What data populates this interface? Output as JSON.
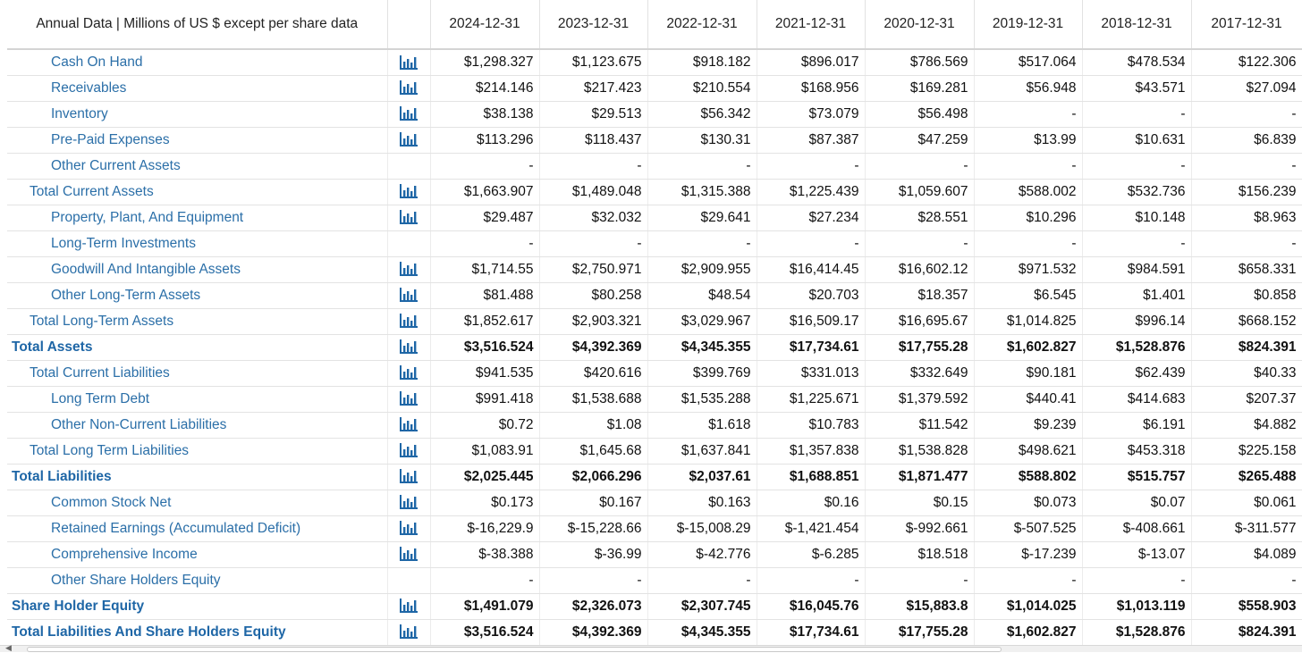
{
  "header": {
    "label": "Annual Data | Millions of US $ except per share data",
    "years": [
      "2024-12-31",
      "2023-12-31",
      "2022-12-31",
      "2021-12-31",
      "2020-12-31",
      "2019-12-31",
      "2018-12-31",
      "2017-12-31"
    ]
  },
  "icon": {
    "name": "bar-chart-icon",
    "color": "#1e66a6"
  },
  "rows": [
    {
      "label": "Cash On Hand",
      "level": 2,
      "bold": false,
      "chart": true,
      "values": [
        "$1,298.327",
        "$1,123.675",
        "$918.182",
        "$896.017",
        "$786.569",
        "$517.064",
        "$478.534",
        "$122.306"
      ]
    },
    {
      "label": "Receivables",
      "level": 2,
      "bold": false,
      "chart": true,
      "values": [
        "$214.146",
        "$217.423",
        "$210.554",
        "$168.956",
        "$169.281",
        "$56.948",
        "$43.571",
        "$27.094"
      ]
    },
    {
      "label": "Inventory",
      "level": 2,
      "bold": false,
      "chart": true,
      "values": [
        "$38.138",
        "$29.513",
        "$56.342",
        "$73.079",
        "$56.498",
        "-",
        "-",
        "-"
      ]
    },
    {
      "label": "Pre-Paid Expenses",
      "level": 2,
      "bold": false,
      "chart": true,
      "values": [
        "$113.296",
        "$118.437",
        "$130.31",
        "$87.387",
        "$47.259",
        "$13.99",
        "$10.631",
        "$6.839"
      ]
    },
    {
      "label": "Other Current Assets",
      "level": 2,
      "bold": false,
      "chart": false,
      "values": [
        "-",
        "-",
        "-",
        "-",
        "-",
        "-",
        "-",
        "-"
      ]
    },
    {
      "label": "Total Current Assets",
      "level": 1,
      "bold": false,
      "chart": true,
      "values": [
        "$1,663.907",
        "$1,489.048",
        "$1,315.388",
        "$1,225.439",
        "$1,059.607",
        "$588.002",
        "$532.736",
        "$156.239"
      ]
    },
    {
      "label": "Property, Plant, And Equipment",
      "level": 2,
      "bold": false,
      "chart": true,
      "values": [
        "$29.487",
        "$32.032",
        "$29.641",
        "$27.234",
        "$28.551",
        "$10.296",
        "$10.148",
        "$8.963"
      ]
    },
    {
      "label": "Long-Term Investments",
      "level": 2,
      "bold": false,
      "chart": false,
      "values": [
        "-",
        "-",
        "-",
        "-",
        "-",
        "-",
        "-",
        "-"
      ]
    },
    {
      "label": "Goodwill And Intangible Assets",
      "level": 2,
      "bold": false,
      "chart": true,
      "values": [
        "$1,714.55",
        "$2,750.971",
        "$2,909.955",
        "$16,414.45",
        "$16,602.12",
        "$971.532",
        "$984.591",
        "$658.331"
      ]
    },
    {
      "label": "Other Long-Term Assets",
      "level": 2,
      "bold": false,
      "chart": true,
      "values": [
        "$81.488",
        "$80.258",
        "$48.54",
        "$20.703",
        "$18.357",
        "$6.545",
        "$1.401",
        "$0.858"
      ]
    },
    {
      "label": "Total Long-Term Assets",
      "level": 1,
      "bold": false,
      "chart": true,
      "values": [
        "$1,852.617",
        "$2,903.321",
        "$3,029.967",
        "$16,509.17",
        "$16,695.67",
        "$1,014.825",
        "$996.14",
        "$668.152"
      ]
    },
    {
      "label": "Total Assets",
      "level": 0,
      "bold": true,
      "chart": true,
      "values": [
        "$3,516.524",
        "$4,392.369",
        "$4,345.355",
        "$17,734.61",
        "$17,755.28",
        "$1,602.827",
        "$1,528.876",
        "$824.391"
      ]
    },
    {
      "label": "Total Current Liabilities",
      "level": 1,
      "bold": false,
      "chart": true,
      "values": [
        "$941.535",
        "$420.616",
        "$399.769",
        "$331.013",
        "$332.649",
        "$90.181",
        "$62.439",
        "$40.33"
      ]
    },
    {
      "label": "Long Term Debt",
      "level": 2,
      "bold": false,
      "chart": true,
      "values": [
        "$991.418",
        "$1,538.688",
        "$1,535.288",
        "$1,225.671",
        "$1,379.592",
        "$440.41",
        "$414.683",
        "$207.37"
      ]
    },
    {
      "label": "Other Non-Current Liabilities",
      "level": 2,
      "bold": false,
      "chart": true,
      "values": [
        "$0.72",
        "$1.08",
        "$1.618",
        "$10.783",
        "$11.542",
        "$9.239",
        "$6.191",
        "$4.882"
      ]
    },
    {
      "label": "Total Long Term Liabilities",
      "level": 1,
      "bold": false,
      "chart": true,
      "values": [
        "$1,083.91",
        "$1,645.68",
        "$1,637.841",
        "$1,357.838",
        "$1,538.828",
        "$498.621",
        "$453.318",
        "$225.158"
      ]
    },
    {
      "label": "Total Liabilities",
      "level": 0,
      "bold": true,
      "chart": true,
      "values": [
        "$2,025.445",
        "$2,066.296",
        "$2,037.61",
        "$1,688.851",
        "$1,871.477",
        "$588.802",
        "$515.757",
        "$265.488"
      ]
    },
    {
      "label": "Common Stock Net",
      "level": 2,
      "bold": false,
      "chart": true,
      "values": [
        "$0.173",
        "$0.167",
        "$0.163",
        "$0.16",
        "$0.15",
        "$0.073",
        "$0.07",
        "$0.061"
      ]
    },
    {
      "label": "Retained Earnings (Accumulated Deficit)",
      "level": 2,
      "bold": false,
      "chart": true,
      "values": [
        "$-16,229.9",
        "$-15,228.66",
        "$-15,008.29",
        "$-1,421.454",
        "$-992.661",
        "$-507.525",
        "$-408.661",
        "$-311.577"
      ]
    },
    {
      "label": "Comprehensive Income",
      "level": 2,
      "bold": false,
      "chart": true,
      "values": [
        "$-38.388",
        "$-36.99",
        "$-42.776",
        "$-6.285",
        "$18.518",
        "$-17.239",
        "$-13.07",
        "$4.089"
      ]
    },
    {
      "label": "Other Share Holders Equity",
      "level": 2,
      "bold": false,
      "chart": false,
      "values": [
        "-",
        "-",
        "-",
        "-",
        "-",
        "-",
        "-",
        "-"
      ]
    },
    {
      "label": "Share Holder Equity",
      "level": 0,
      "bold": true,
      "chart": true,
      "values": [
        "$1,491.079",
        "$2,326.073",
        "$2,307.745",
        "$16,045.76",
        "$15,883.8",
        "$1,014.025",
        "$1,013.119",
        "$558.903"
      ]
    },
    {
      "label": "Total Liabilities And Share Holders Equity",
      "level": 0,
      "bold": true,
      "chart": true,
      "values": [
        "$3,516.524",
        "$4,392.369",
        "$4,345.355",
        "$17,734.61",
        "$17,755.28",
        "$1,602.827",
        "$1,528.876",
        "$824.391"
      ]
    }
  ],
  "scrollbar": {
    "arrow_icon": "scroll-left-arrow-icon"
  }
}
